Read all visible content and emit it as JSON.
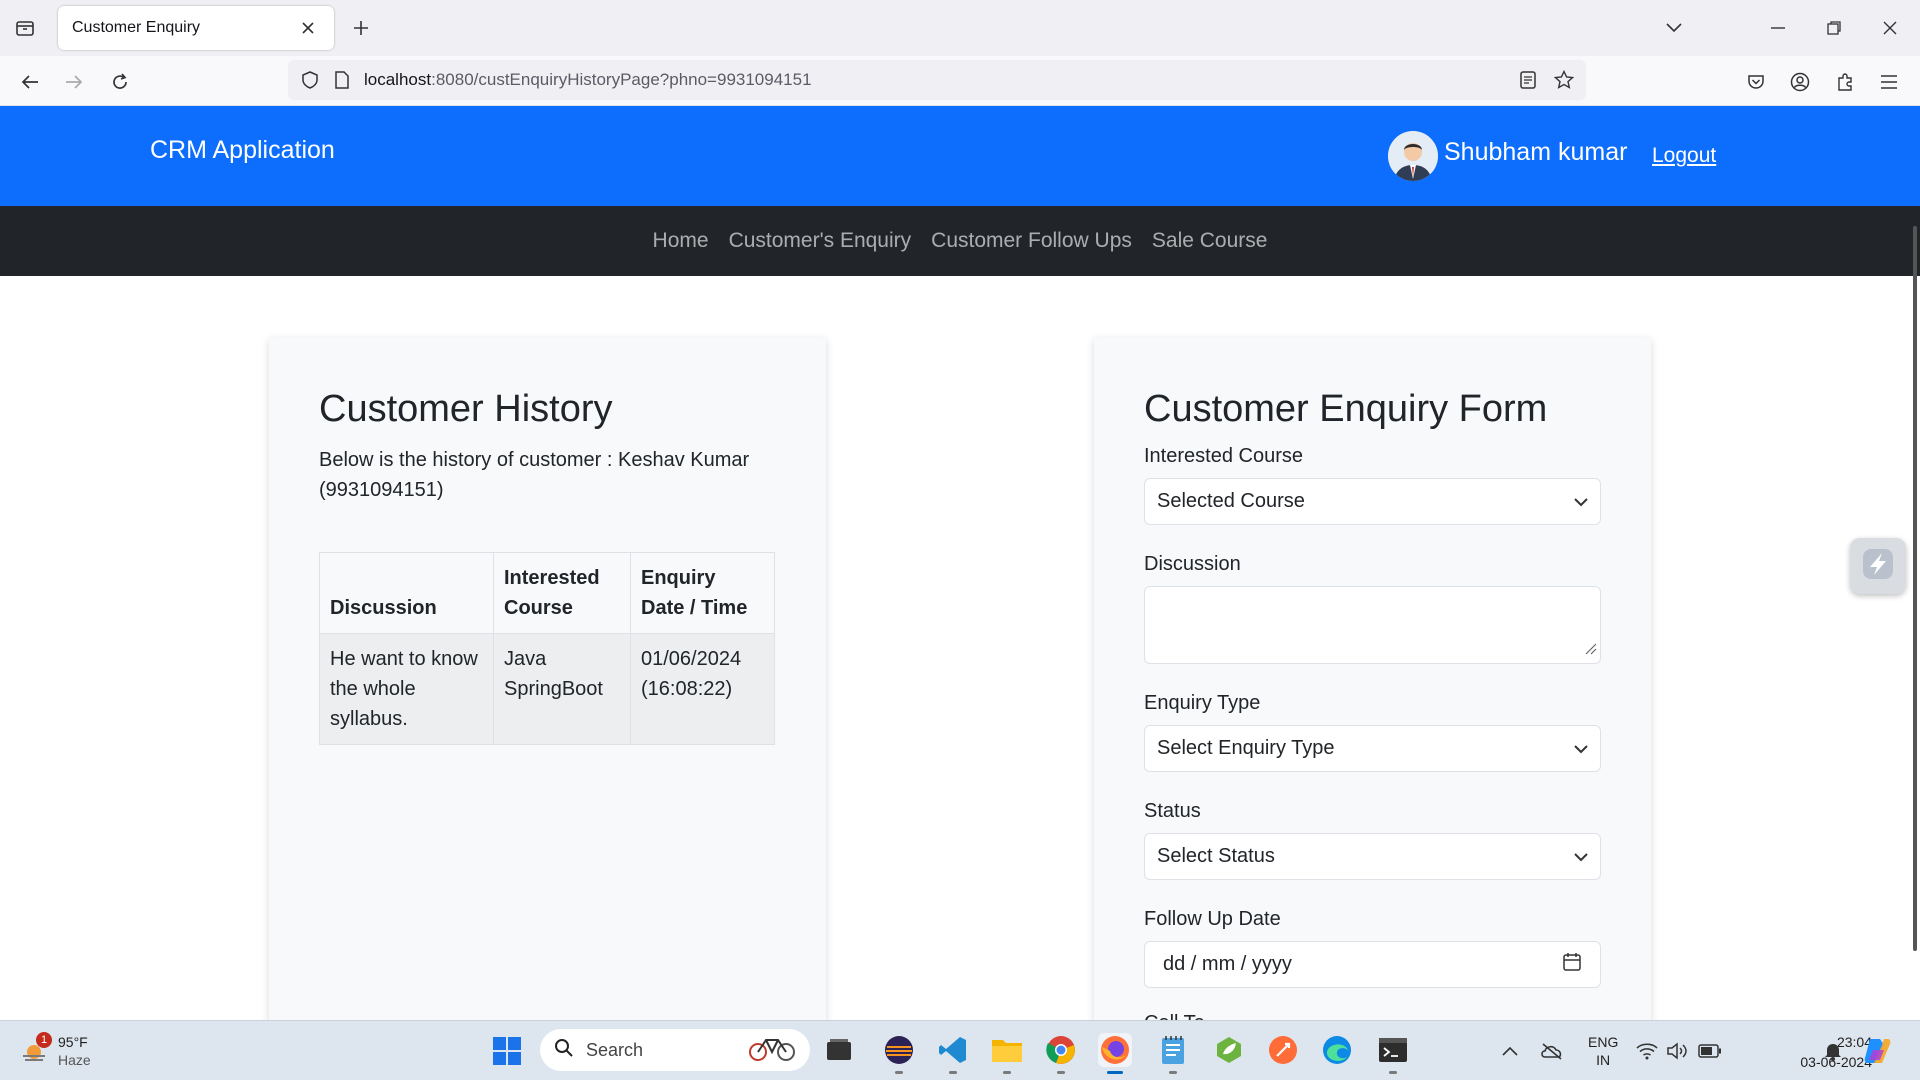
{
  "browser": {
    "tab_title": "Customer Enquiry",
    "url_host": "localhost",
    "url_rest": ":8080/custEnquiryHistoryPage?phno=9931094151"
  },
  "header": {
    "brand": "CRM Application",
    "user_name": "Shubham kumar",
    "logout": "Logout"
  },
  "menu": {
    "items": [
      "Home",
      "Customer's Enquiry",
      "Customer Follow Ups",
      "Sale Course"
    ]
  },
  "history": {
    "title": "Customer History",
    "description": "Below is the history of customer : Keshav Kumar (9931094151)",
    "columns": [
      "Discussion",
      "Interested Course",
      "Enquiry Date / Time"
    ],
    "rows": [
      {
        "discussion": "He want to know the whole syllabus.",
        "course": "Java SpringBoot",
        "datetime": "01/06/2024 (16:08:22)"
      }
    ]
  },
  "form": {
    "title": "Customer Enquiry Form",
    "course_label": "Interested Course",
    "course_value": "Selected Course",
    "discussion_label": "Discussion",
    "enquiry_type_label": "Enquiry Type",
    "enquiry_type_value": "Select Enquiry Type",
    "status_label": "Status",
    "status_value": "Select Status",
    "followup_label": "Follow Up Date",
    "followup_placeholder": "dd / mm / yyyy",
    "next_label_partial": "Call To"
  },
  "taskbar": {
    "weather_temp": "95°F",
    "weather_desc": "Haze",
    "weather_badge": "1",
    "search_label": "Search",
    "lang_top": "ENG",
    "lang_bottom": "IN",
    "time": "23:04",
    "date": "03-06-2024"
  },
  "colors": {
    "header_bg": "#0d6efd",
    "menu_bg": "#212529",
    "card_bg": "#f8f9fa"
  }
}
